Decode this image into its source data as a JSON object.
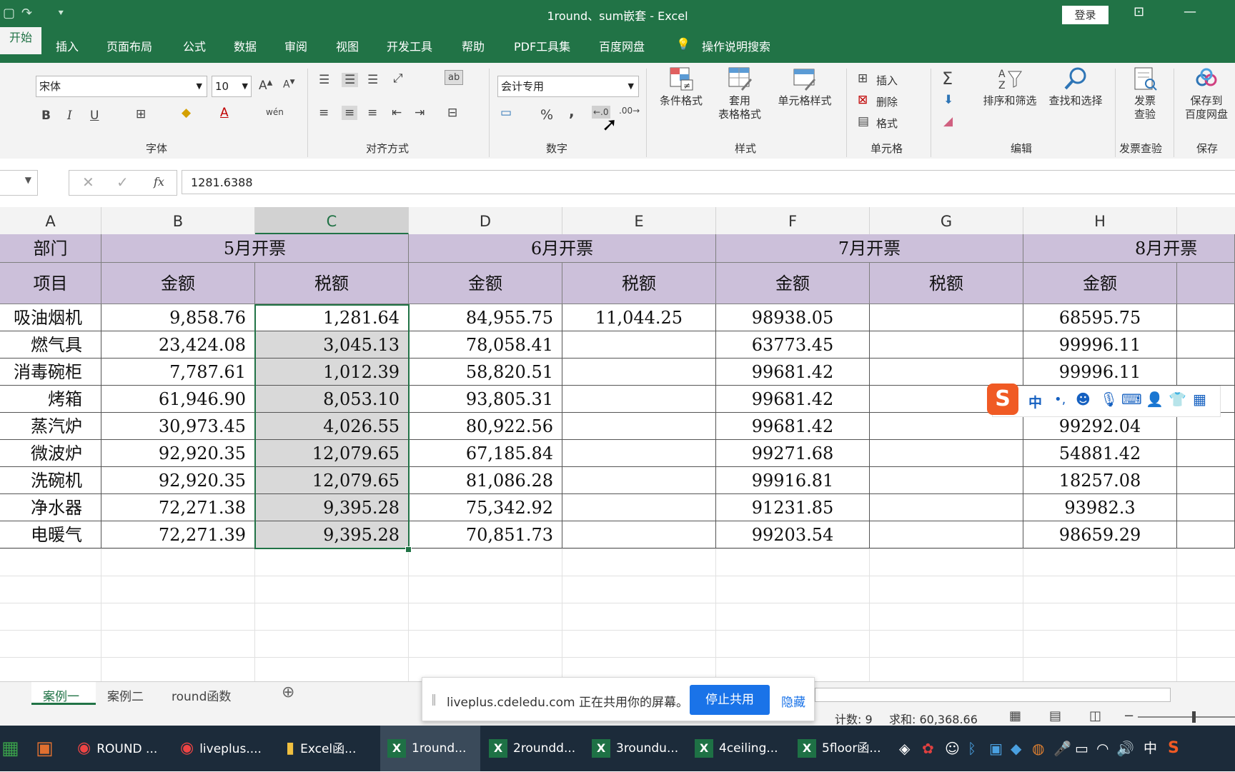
{
  "window": {
    "title": "1round、sum嵌套 - Excel",
    "login": "登录"
  },
  "tabs": [
    "开始",
    "插入",
    "页面布局",
    "公式",
    "数据",
    "审阅",
    "视图",
    "开发工具",
    "帮助",
    "PDF工具集",
    "百度网盘"
  ],
  "tell_me": "操作说明搜索",
  "ribbon": {
    "font_name": "宋体",
    "font_size": "10",
    "number_format": "会计专用",
    "groups": {
      "font": "字体",
      "alignment": "对齐方式",
      "number": "数字",
      "styles": "样式",
      "cells": "单元格",
      "editing": "编辑",
      "invoice": "发票查验",
      "save": "保存"
    },
    "buttons": {
      "conditional": "条件格式",
      "table_fmt_1": "套用",
      "table_fmt_2": "表格格式",
      "cell_styles": "单元格样式",
      "insert": "插入",
      "delete": "删除",
      "format": "格式",
      "sort_filter": "排序和筛选",
      "find_select": "查找和选择",
      "invoice_1": "发票",
      "invoice_2": "查验",
      "save_1": "保存到",
      "save_2": "百度网盘",
      "bold": "B",
      "italic": "I",
      "underline": "U",
      "percent": "%",
      "comma": ",",
      "wen": "wén",
      "ab": "ab"
    }
  },
  "formula_bar": {
    "value": "1281.6388",
    "fx": "fx"
  },
  "columns": [
    "A",
    "B",
    "C",
    "D",
    "E",
    "F",
    "G",
    "H"
  ],
  "sheet": {
    "row1": {
      "a": "部门",
      "may": "5月开票",
      "jun": "6月开票",
      "jul": "7月开票",
      "aug": "8月开票"
    },
    "row2": {
      "a": "项目",
      "amount": "金额",
      "tax": "税额"
    },
    "rows": [
      {
        "item": "吸油烟机",
        "b": "9,858.76",
        "c": "1,281.64",
        "d": "84,955.75",
        "e": "11,044.25",
        "f": "98938.05",
        "g": "",
        "h": "68595.75"
      },
      {
        "item": "燃气具",
        "b": "23,424.08",
        "c": "3,045.13",
        "d": "78,058.41",
        "e": "",
        "f": "63773.45",
        "g": "",
        "h": "99996.11"
      },
      {
        "item": "消毒碗柜",
        "b": "7,787.61",
        "c": "1,012.39",
        "d": "58,820.51",
        "e": "",
        "f": "99681.42",
        "g": "",
        "h": "99996.11"
      },
      {
        "item": "烤箱",
        "b": "61,946.90",
        "c": "8,053.10",
        "d": "93,805.31",
        "e": "",
        "f": "99681.42",
        "g": "",
        "h": ""
      },
      {
        "item": "蒸汽炉",
        "b": "30,973.45",
        "c": "4,026.55",
        "d": "80,922.56",
        "e": "",
        "f": "99681.42",
        "g": "",
        "h": "99292.04"
      },
      {
        "item": "微波炉",
        "b": "92,920.35",
        "c": "12,079.65",
        "d": "67,185.84",
        "e": "",
        "f": "99271.68",
        "g": "",
        "h": "54881.42"
      },
      {
        "item": "洗碗机",
        "b": "92,920.35",
        "c": "12,079.65",
        "d": "81,086.28",
        "e": "",
        "f": "99916.81",
        "g": "",
        "h": "18257.08"
      },
      {
        "item": "净水器",
        "b": "72,271.38",
        "c": "9,395.28",
        "d": "75,342.92",
        "e": "",
        "f": "91231.85",
        "g": "",
        "h": "93982.3"
      },
      {
        "item": "电暖气",
        "b": "72,271.39",
        "c": "9,395.28",
        "d": "70,851.73",
        "e": "",
        "f": "99203.54",
        "g": "",
        "h": "98659.29"
      }
    ]
  },
  "sheet_tabs": [
    "案例一",
    "案例二",
    "round函数"
  ],
  "status": {
    "count": "计数: 9",
    "sum": "求和: 60,368.66"
  },
  "share_notice": {
    "text": "liveplus.cdeledu.com 正在共用你的屏幕。",
    "stop": "停止共用",
    "hide": "隐藏"
  },
  "ime": {
    "lang": "中"
  },
  "taskbar": {
    "items": [
      "ROUND ...",
      "liveplus....",
      "Excel函...",
      "1round...",
      "2roundd...",
      "3roundu...",
      "4ceiling...",
      "5floor函..."
    ],
    "tray_lang": "中"
  }
}
